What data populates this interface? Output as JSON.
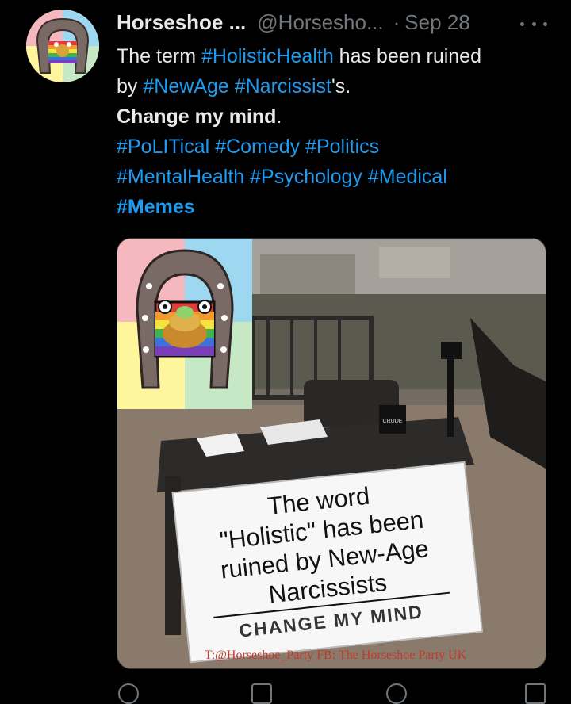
{
  "tweet": {
    "display_name": "Horseshoe ...",
    "handle": "@Horsesho...",
    "separator": "·",
    "date": "Sep 28",
    "line1_prefix": "The term ",
    "tag_holistic": "#HolisticHealth",
    "line1_suffix": " has been ruined",
    "line2_prefix": "by ",
    "tag_newage": "#NewAge",
    "tag_narcissist": "#Narcissist",
    "line2_suffix": "'s.",
    "change_mind": "Change my mind",
    "change_mind_period": ".",
    "tags_line3": "#PoLITical #Comedy #Politics",
    "tags_line4": "#MentalHealth #Psychology #Medical",
    "tags_line5": "#Memes"
  },
  "meme": {
    "sign_line1": "The word",
    "sign_line2": "\"Holistic\" has been",
    "sign_line3": "ruined by New-Age",
    "sign_line4": "Narcissists",
    "sign_banner": "CHANGE MY MIND",
    "watermark": "T:@Horseshoe_Party FB: The Horseshoe Party UK",
    "mug_text": "CRUDE"
  },
  "icons": {
    "more": "more-horizontal-icon",
    "reply": "reply-icon",
    "retweet": "retweet-icon",
    "like": "heart-icon",
    "share": "share-icon"
  },
  "colors": {
    "link": "#1d9bf0",
    "secondary_text": "#71767b",
    "primary_text": "#e7e9ea",
    "background": "#000000"
  }
}
